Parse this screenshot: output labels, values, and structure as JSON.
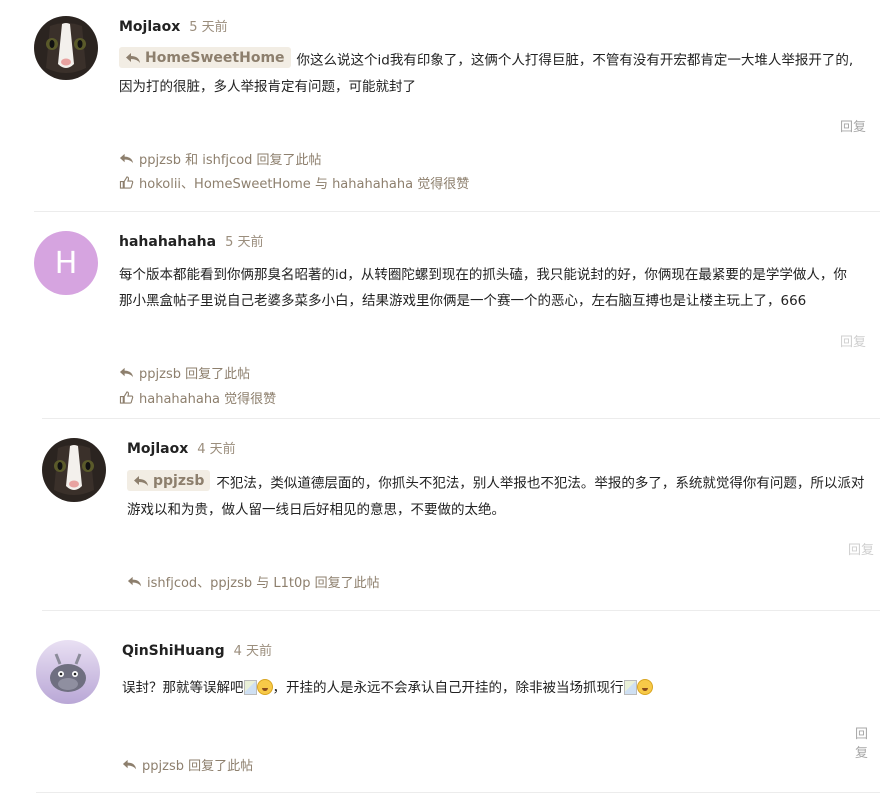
{
  "posts": [
    {
      "username": "Mojlaox",
      "time": "5 天前",
      "quote": "HomeSweetHome",
      "line1": "你这么说这个id我有印象了，这俩个人打得巨脏，不管有没有开宏都肯定一大堆人举报开了的,",
      "line2": "因为打的很脏，多人举报肯定有问题，可能就封了",
      "reply_label": "回复",
      "replied": "ppjzsb 和 ishfjcod 回复了此帖",
      "liked": "hokolii、HomeSweetHome 与 hahahahaha 觉得很赞"
    },
    {
      "username": "hahahahaha",
      "avatar_letter": "H",
      "avatar_color": "#d6a4e0",
      "time": "5 天前",
      "line1": "每个版本都能看到你俩那臭名昭著的id，从转圈陀螺到现在的抓头磕，我只能说封的好，你俩现在最紧要的是学学做人，你",
      "line2": "那小黑盒帖子里说自己老婆多菜多小白，结果游戏里你俩是一个赛一个的恶心，左右脑互搏也是让楼主玩上了，666",
      "reply_label": "回复",
      "replied": "ppjzsb 回复了此帖",
      "liked": "hahahahaha 觉得很赞"
    },
    {
      "username": "Mojlaox",
      "time": "4 天前",
      "quote": "ppjzsb",
      "line1": "不犯法，类似道德层面的，你抓头不犯法，别人举报也不犯法。举报的多了，系统就觉得你有问题，所以派对",
      "line2": "游戏以和为贵，做人留一线日后好相见的意思，不要做的太绝。",
      "reply_label": "回复",
      "replied": "ishfjcod、ppjzsb 与 L1t0p 回复了此帖"
    },
    {
      "username": "QinShiHuang",
      "time": "4 天前",
      "line1a": "误封？那就等误解吧",
      "line1b": "，开挂的人是永远不会承认自己开挂的，除非被当场抓现行",
      "reply_label": "回复",
      "replied": "ppjzsb 回复了此帖"
    }
  ],
  "colors": {
    "accent": "#8d7f6d",
    "quote_bg": "#f2ede4",
    "time": "#9b8e7d",
    "separator": "#ececec"
  },
  "icons": [
    "reply-arrow-icon",
    "thumbs-up-icon",
    "laugh-emoji-icon",
    "broken-image-icon"
  ]
}
